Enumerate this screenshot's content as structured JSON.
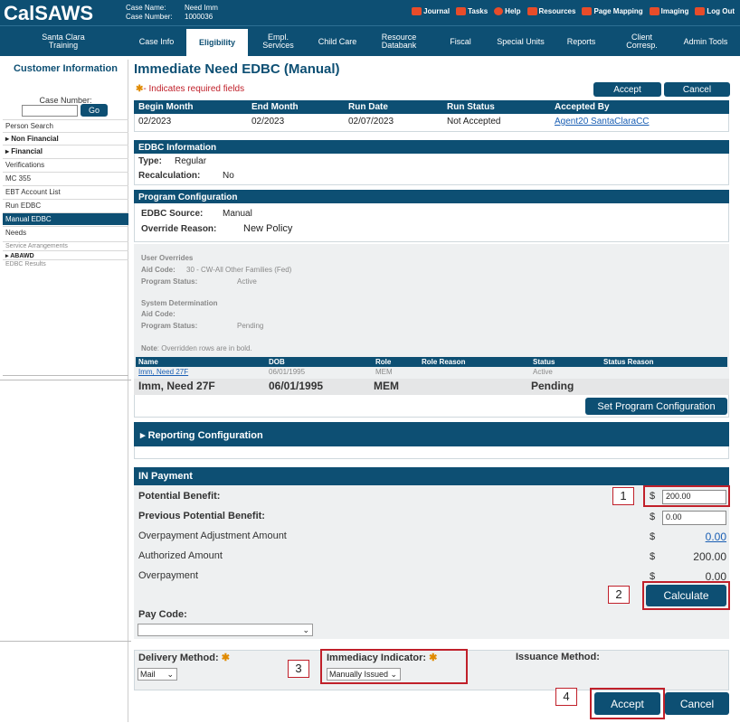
{
  "app": {
    "logo_cal": "Cal",
    "logo_saws": "SAWS"
  },
  "case": {
    "name_label": "Case Name:",
    "name_value": "Need Imm",
    "number_label": "Case Number:",
    "number_value": "1000036"
  },
  "toplinks": [
    "Journal",
    "Tasks",
    "Help",
    "Resources",
    "Page Mapping",
    "Imaging",
    "Log Out"
  ],
  "nav": [
    "Santa Clara Training",
    "Case Info",
    "Eligibility",
    "Empl. Services",
    "Child Care",
    "Resource Databank",
    "Fiscal",
    "Special Units",
    "Reports",
    "Client Corresp.",
    "Admin Tools"
  ],
  "sidebar": {
    "title": "Customer Information",
    "case_number_label": "Case Number:",
    "go": "Go",
    "items": [
      "Person Search",
      "Non Financial",
      "Financial",
      "Verifications",
      "MC 355",
      "EBT Account List",
      "Run EDBC",
      "Manual EDBC",
      "Needs"
    ],
    "items2": [
      "Service Arrangements",
      "ABAWD",
      "EDBC Results"
    ]
  },
  "page": {
    "title": "Immediate Need EDBC (Manual)",
    "required_note": "- Indicates required fields",
    "accept": "Accept",
    "cancel": "Cancel"
  },
  "run_table": {
    "headers": [
      "Begin Month",
      "End Month",
      "Run Date",
      "Run Status",
      "Accepted By"
    ],
    "row": [
      "02/2023",
      "02/2023",
      "02/07/2023",
      "Not Accepted",
      "Agent20 SantaClaraCC"
    ]
  },
  "edbc_info": {
    "header": "EDBC Information",
    "type_label": "Type:",
    "type_value": "Regular",
    "recalc_label": "Recalculation:",
    "recalc_value": "No"
  },
  "program_config": {
    "header": "Program Configuration",
    "source_label": "EDBC Source:",
    "source_value": "Manual",
    "override_label": "Override Reason:",
    "override_value": "New Policy",
    "user_overrides": "User Overrides",
    "aid_code_label": "Aid Code:",
    "aid_code_value": "30 - CW-All Other Families (Fed)",
    "program_status_label": "Program Status:",
    "program_status_value": "Active",
    "system_determination": "System Determination",
    "sys_aid_code_label": "Aid Code:",
    "sys_status_label": "Program Status:",
    "sys_status_value": "Pending",
    "note_label": "Note",
    "note_text": ": Overridden rows are in bold.",
    "table_headers": [
      "Name",
      "DOB",
      "Role",
      "Role Reason",
      "Status",
      "Status Reason"
    ],
    "row1": [
      "Imm, Need 27F",
      "06/01/1995",
      "MEM",
      "",
      "Active",
      ""
    ],
    "row2": [
      "Imm, Need 27F",
      "06/01/1995",
      "MEM",
      "",
      "Pending",
      ""
    ],
    "set_button": "Set Program Configuration"
  },
  "reporting": {
    "header": "Reporting Configuration"
  },
  "payment": {
    "header": "IN Payment",
    "potential_label": "Potential Benefit:",
    "potential_value": "200.00",
    "previous_label": "Previous Potential Benefit:",
    "previous_value": "0.00",
    "overpay_adj_label": "Overpayment Adjustment Amount",
    "overpay_adj_value": "0.00",
    "authorized_label": "Authorized Amount",
    "authorized_value": "200.00",
    "overpayment_label": "Overpayment",
    "overpayment_value": "0.00",
    "currency": "$",
    "calculate": "Calculate",
    "pay_code_label": "Pay Code:",
    "pay_code_value": ""
  },
  "delivery": {
    "delivery_label": "Delivery Method:",
    "delivery_value": "Mail",
    "immediacy_label": "Immediacy Indicator:",
    "immediacy_value": "Manually Issued",
    "issuance_label": "Issuance Method:"
  },
  "markers": [
    "1",
    "2",
    "3",
    "4"
  ],
  "colors": {
    "primary": "#0d4f73",
    "required": "#e08a00",
    "highlight": "#c0202a"
  }
}
